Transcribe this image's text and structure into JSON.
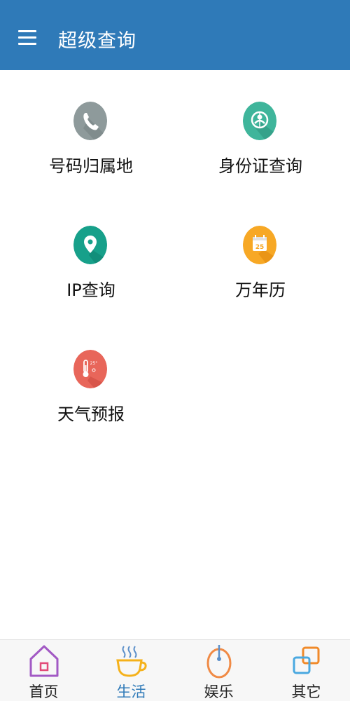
{
  "header": {
    "menu_icon": "hamburger-menu-icon",
    "title": "超级查询"
  },
  "tiles": [
    {
      "label": "号码归属地",
      "icon": "phone-icon",
      "color": "#8e9a9b"
    },
    {
      "label": "身份证查询",
      "icon": "id-card-icon",
      "color": "#3fb59b"
    },
    {
      "label": "IP查询",
      "icon": "location-pin-icon",
      "color": "#17a08a"
    },
    {
      "label": "万年历",
      "icon": "calendar-icon",
      "color": "#f7a825",
      "calendar_day": "25"
    },
    {
      "label": "天气预报",
      "icon": "thermometer-icon",
      "color": "#e8665a",
      "temp_text": "25°"
    }
  ],
  "bottom_nav": [
    {
      "label": "首页",
      "icon": "home-icon",
      "active": false
    },
    {
      "label": "生活",
      "icon": "coffee-cup-icon",
      "active": true
    },
    {
      "label": "娱乐",
      "icon": "mouse-icon",
      "active": false
    },
    {
      "label": "其它",
      "icon": "squares-icon",
      "active": false
    }
  ],
  "colors": {
    "app_bar": "#2f7ab8",
    "active_tab": "#2f7ab8",
    "nav_home": "#a259c4",
    "nav_life": "#f5b11a",
    "nav_fun": "#f08a45",
    "nav_other": "#f08a2a"
  }
}
